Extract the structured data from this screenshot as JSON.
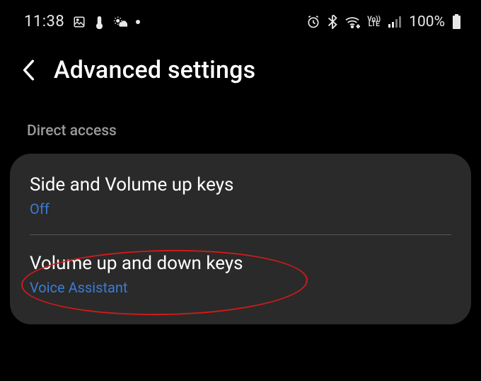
{
  "status": {
    "time": "11:38",
    "battery": "100%"
  },
  "header": {
    "title": "Advanced settings"
  },
  "section": {
    "label": "Direct access"
  },
  "rows": {
    "side_volume": {
      "title": "Side and Volume up keys",
      "sub": "Off"
    },
    "vol_up_down": {
      "title": "Volume up and down keys",
      "sub": "Voice Assistant"
    }
  },
  "volte": {
    "top": "Vo))",
    "bottom": "LTE"
  }
}
